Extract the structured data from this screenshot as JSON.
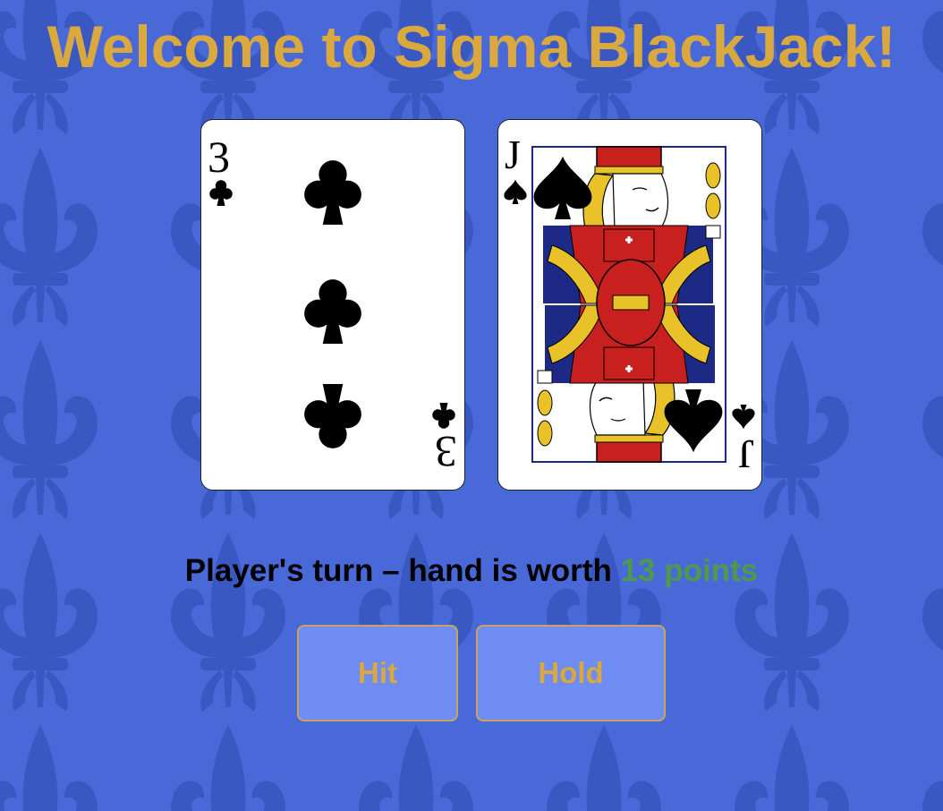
{
  "title": "Welcome to Sigma BlackJack!",
  "colors": {
    "background": "#4a69d8",
    "pattern": "#3a58c2",
    "title": "#d9a83e",
    "points": "#4f9a4a",
    "button_fill": "#6e8cf2",
    "button_border": "#c9a657"
  },
  "background_pattern": "fleur-de-lis",
  "hand": {
    "cards": [
      {
        "rank": "3",
        "suit": "clubs",
        "suit_symbol": "♣"
      },
      {
        "rank": "J",
        "suit": "spades",
        "suit_symbol": "♠"
      }
    ]
  },
  "status": {
    "prefix": "Player's turn – hand is worth ",
    "points": "13 points"
  },
  "buttons": {
    "hit_label": "Hit",
    "hold_label": "Hold"
  }
}
